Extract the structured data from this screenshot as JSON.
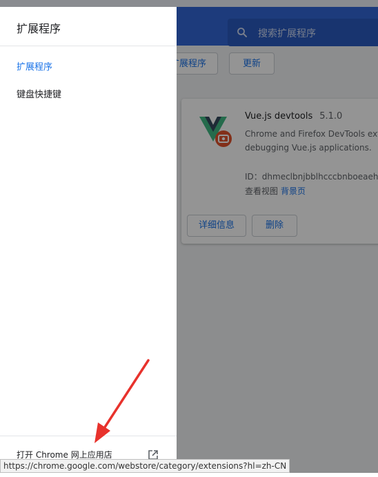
{
  "header": {
    "search_placeholder": "搜索扩展程序"
  },
  "toolbar": {
    "pack_label": "扩展程序",
    "update_label": "更新"
  },
  "extension_card": {
    "name": "Vue.js devtools",
    "version": "5.1.0",
    "description_line1": "Chrome and Firefox DevTools exte",
    "description_line2": "debugging Vue.js applications.",
    "id_label": "ID：",
    "id_value": "dhmeclbnjbblhcccbnboeaehli",
    "views_label": "查看视图",
    "views_link": "背景页",
    "details_button": "详细信息",
    "remove_button": "删除"
  },
  "drawer": {
    "title": "扩展程序",
    "items": [
      {
        "label": "扩展程序",
        "active": true
      },
      {
        "label": "键盘快捷键",
        "active": false
      }
    ],
    "store_link": "打开 Chrome 网上应用店"
  },
  "status_url": "https://chrome.google.com/webstore/category/extensions?hl=zh-CN",
  "colors": {
    "header_bg": "#3367d6",
    "accent": "#1a73e8",
    "annotation_arrow": "#e8322c",
    "vue_green": "#41b883",
    "vue_dark": "#35495e",
    "badge_red": "#e0512b"
  },
  "icons": [
    "search-icon",
    "vue-devtools-logo",
    "external-link-icon",
    "red-arrow-annotation"
  ]
}
